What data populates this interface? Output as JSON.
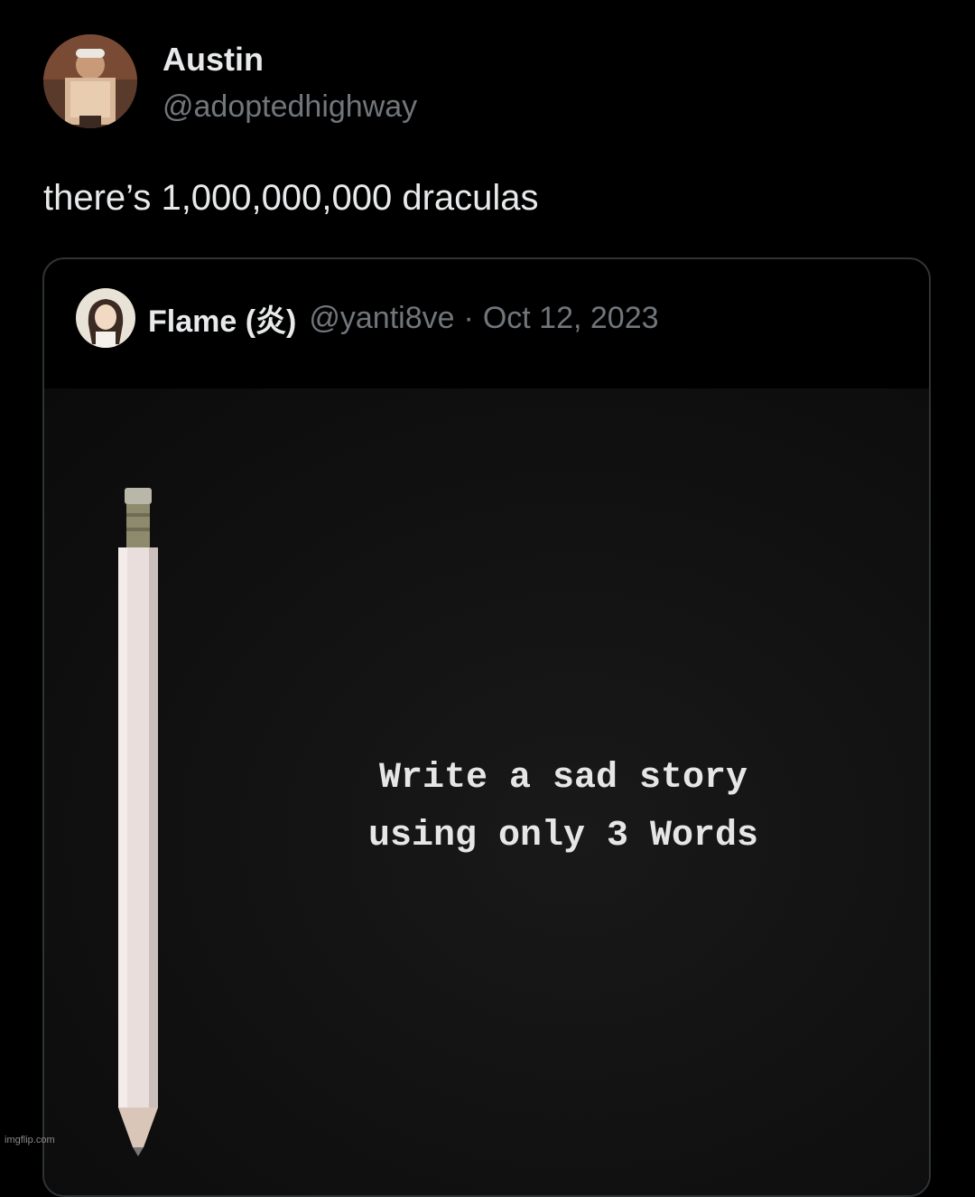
{
  "tweet": {
    "author_name": "Austin",
    "author_handle": "@adoptedhighway",
    "text": "there’s 1,000,000,000 draculas"
  },
  "quoted_tweet": {
    "author_name": "Flame (炎)",
    "author_handle": "@yanti8ve",
    "separator": "·",
    "date": "Oct 12, 2023",
    "media_text_line1": "Write a sad story",
    "media_text_line2": "using only 3 Words"
  },
  "watermark": "imgflip.com",
  "colors": {
    "background": "#000000",
    "primary_text": "#e7e9ea",
    "secondary_text": "#71767b",
    "card_border": "#2f3336"
  }
}
